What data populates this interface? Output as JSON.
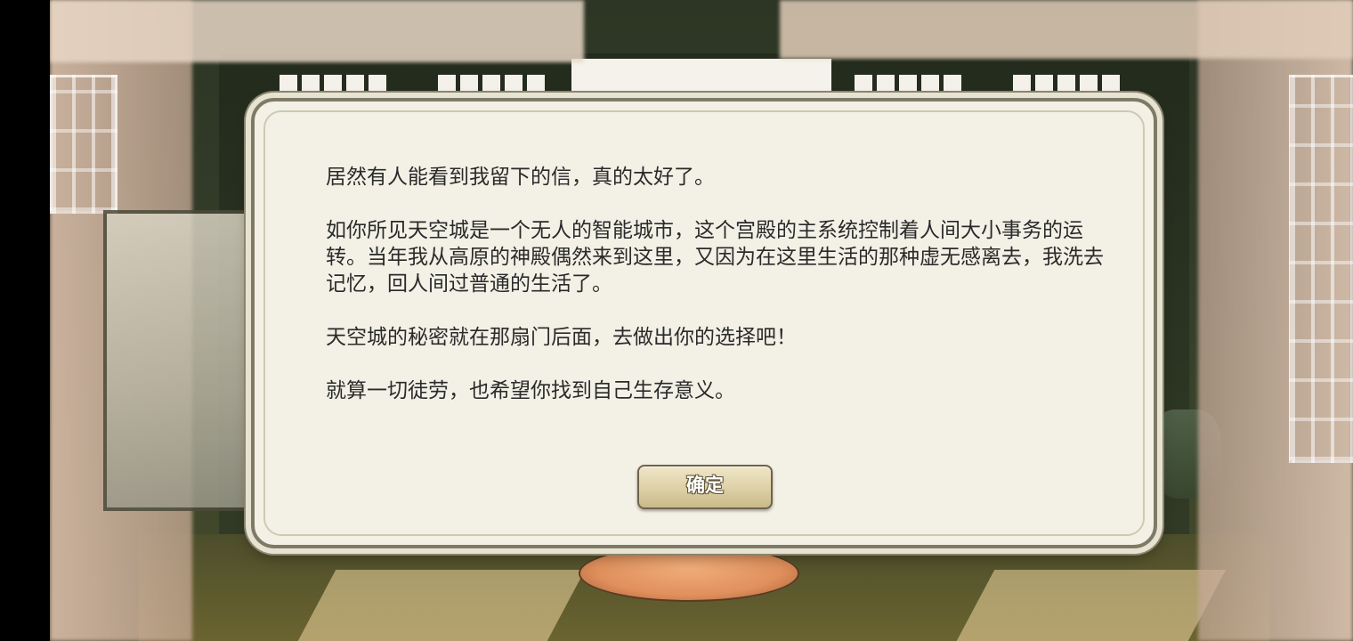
{
  "dialog": {
    "paragraphs": [
      "居然有人能看到我留下的信，真的太好了。",
      "如你所见天空城是一个无人的智能城市，这个宫殿的主系统控制着人间大小事务的运转。当年我从高原的神殿偶然来到这里，又因为在这里生活的那种虚无感离去，我洗去记忆，回人间过普通的生活了。",
      "天空城的秘密就在那扇门后面，去做出你的选择吧！",
      "就算一切徒劳，也希望你找到自己生存意义。"
    ],
    "confirm_label": "确定"
  },
  "colors": {
    "dialog_background": "#f3f1e6",
    "dialog_border": "#7f7a65",
    "button_fill": "#ddd0a6",
    "text": "#2a2a2a"
  }
}
